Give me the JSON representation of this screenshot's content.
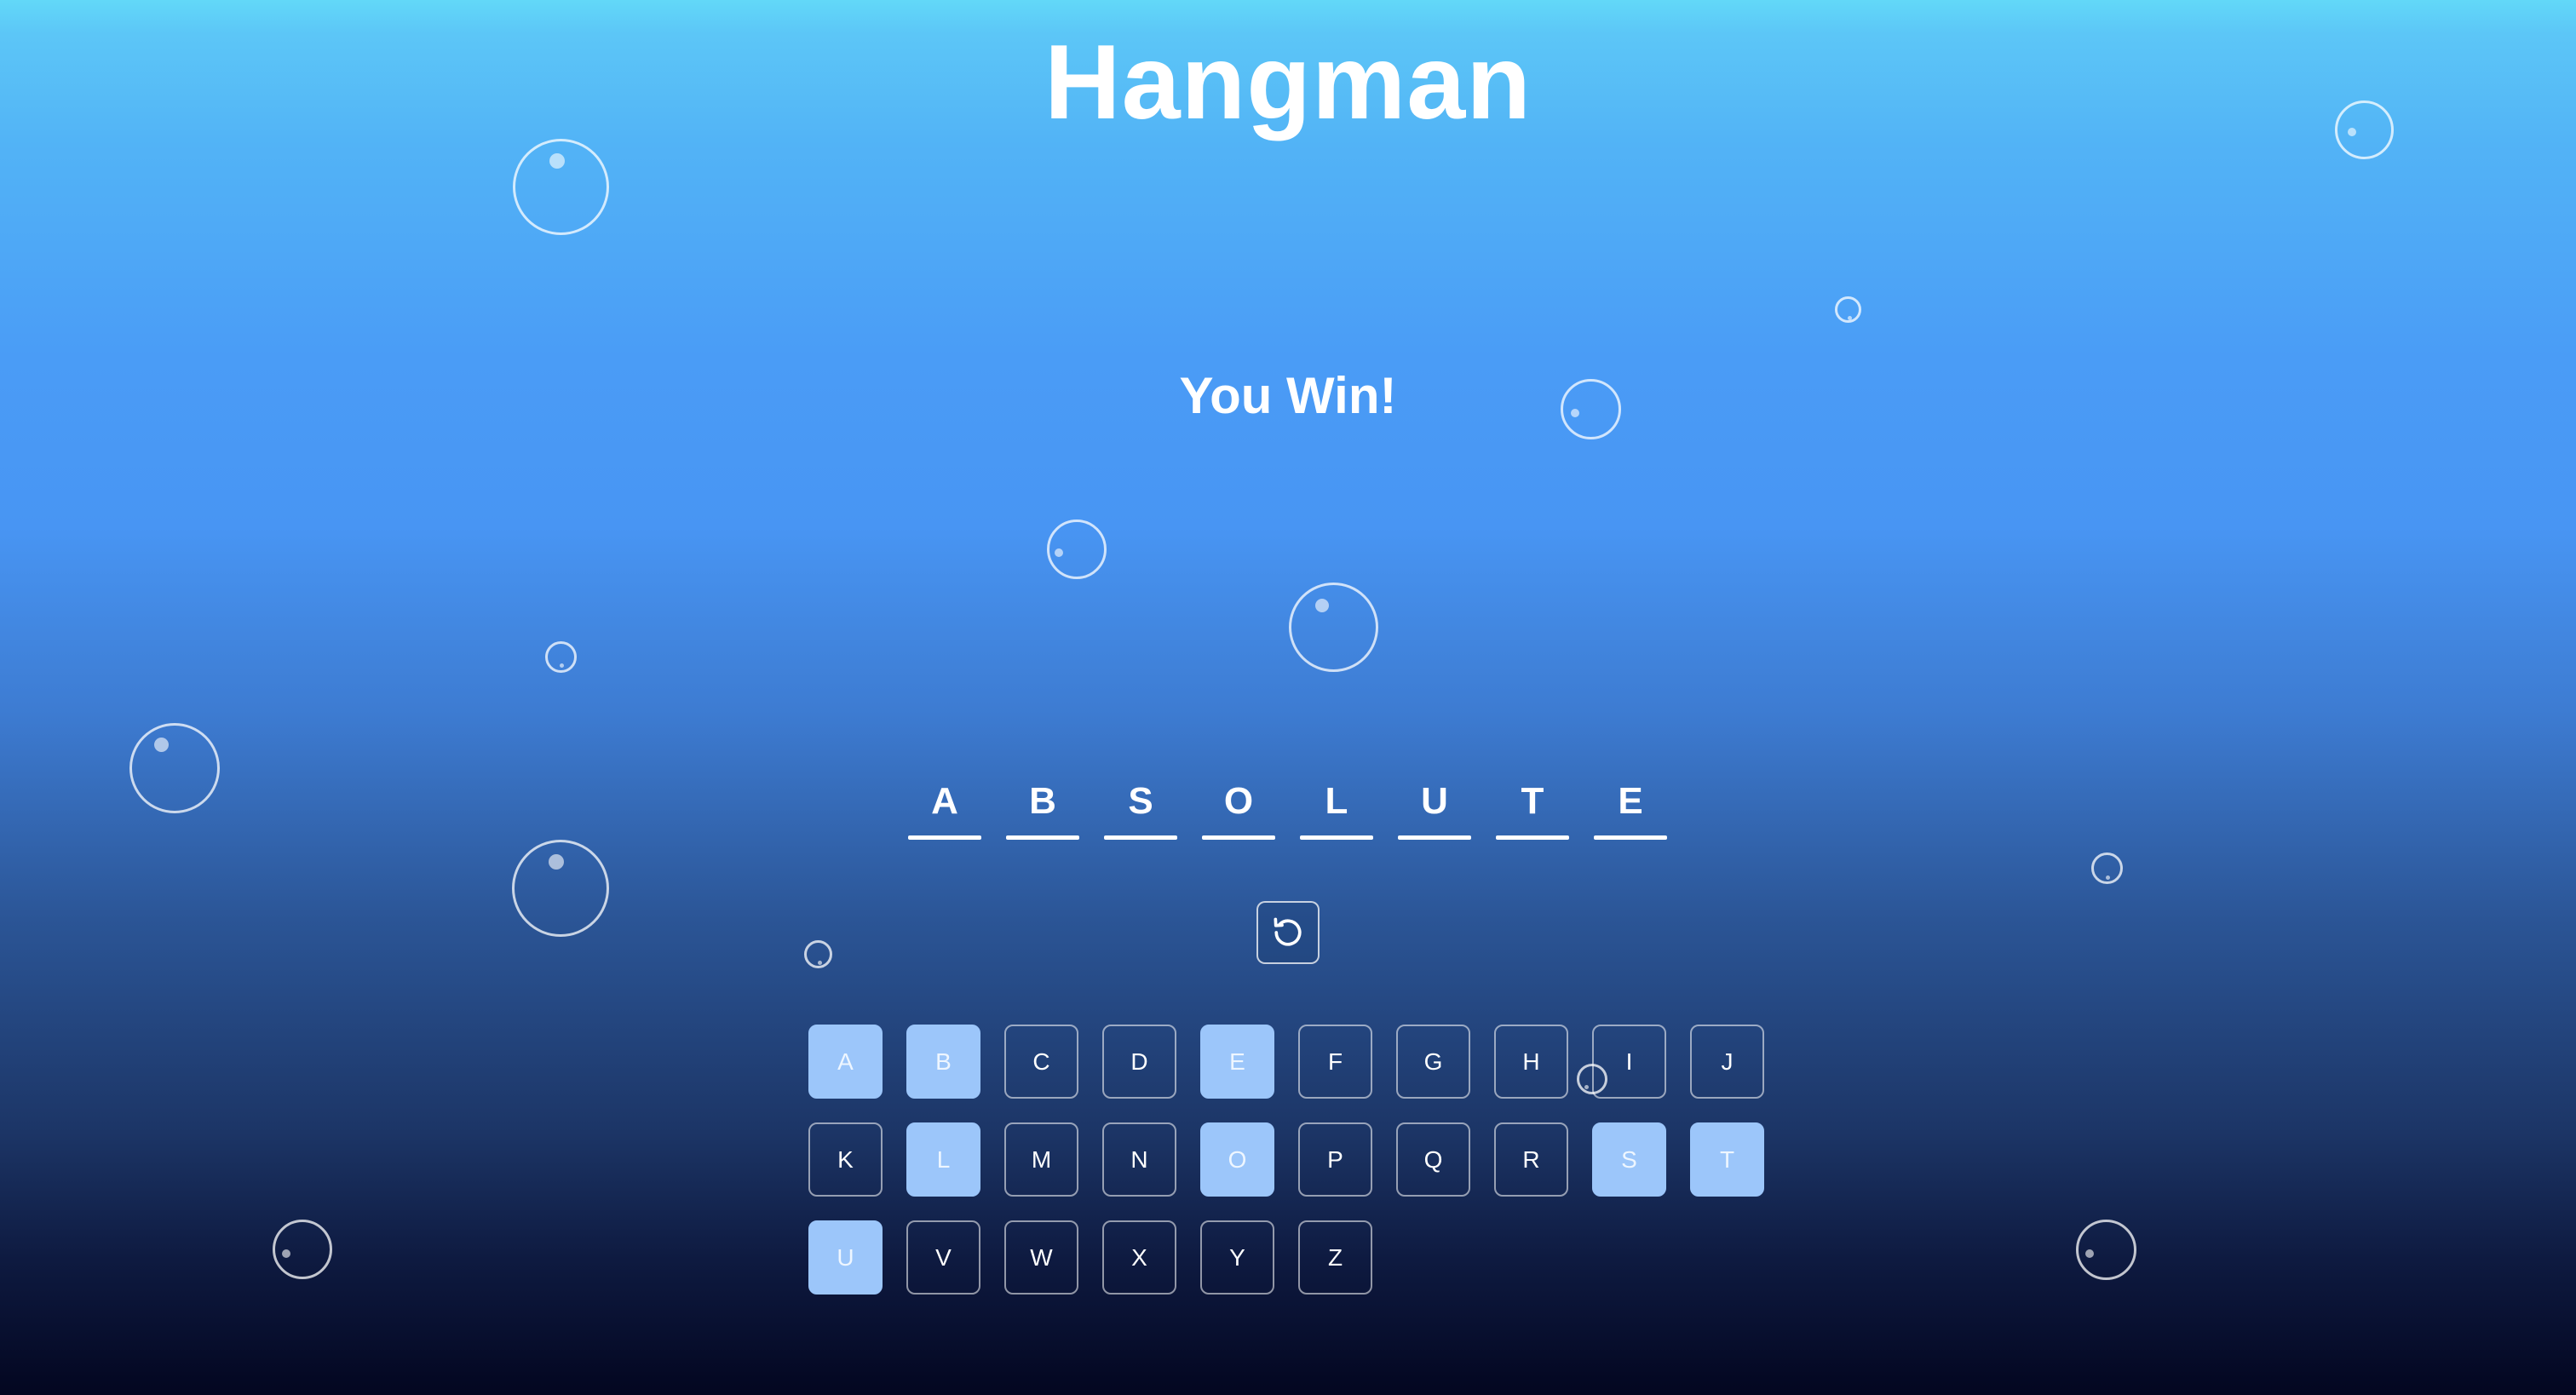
{
  "game": {
    "title": "Hangman",
    "status_message": "You Win!"
  },
  "word": {
    "letters": [
      "A",
      "B",
      "S",
      "O",
      "L",
      "U",
      "T",
      "E"
    ]
  },
  "reset_icon": "restart-icon",
  "keyboard": {
    "keys": [
      {
        "letter": "A",
        "used": true
      },
      {
        "letter": "B",
        "used": true
      },
      {
        "letter": "C",
        "used": false
      },
      {
        "letter": "D",
        "used": false
      },
      {
        "letter": "E",
        "used": true
      },
      {
        "letter": "F",
        "used": false
      },
      {
        "letter": "G",
        "used": false
      },
      {
        "letter": "H",
        "used": false
      },
      {
        "letter": "I",
        "used": false
      },
      {
        "letter": "J",
        "used": false
      },
      {
        "letter": "K",
        "used": false
      },
      {
        "letter": "L",
        "used": true
      },
      {
        "letter": "M",
        "used": false
      },
      {
        "letter": "N",
        "used": false
      },
      {
        "letter": "O",
        "used": true
      },
      {
        "letter": "P",
        "used": false
      },
      {
        "letter": "Q",
        "used": false
      },
      {
        "letter": "R",
        "used": false
      },
      {
        "letter": "S",
        "used": true
      },
      {
        "letter": "T",
        "used": true
      },
      {
        "letter": "U",
        "used": true
      },
      {
        "letter": "V",
        "used": false
      },
      {
        "letter": "W",
        "used": false
      },
      {
        "letter": "X",
        "used": false
      },
      {
        "letter": "Y",
        "used": false
      },
      {
        "letter": "Z",
        "used": false
      }
    ]
  },
  "colors": {
    "used_key": "#9cc6fa",
    "text": "#ffffff"
  }
}
